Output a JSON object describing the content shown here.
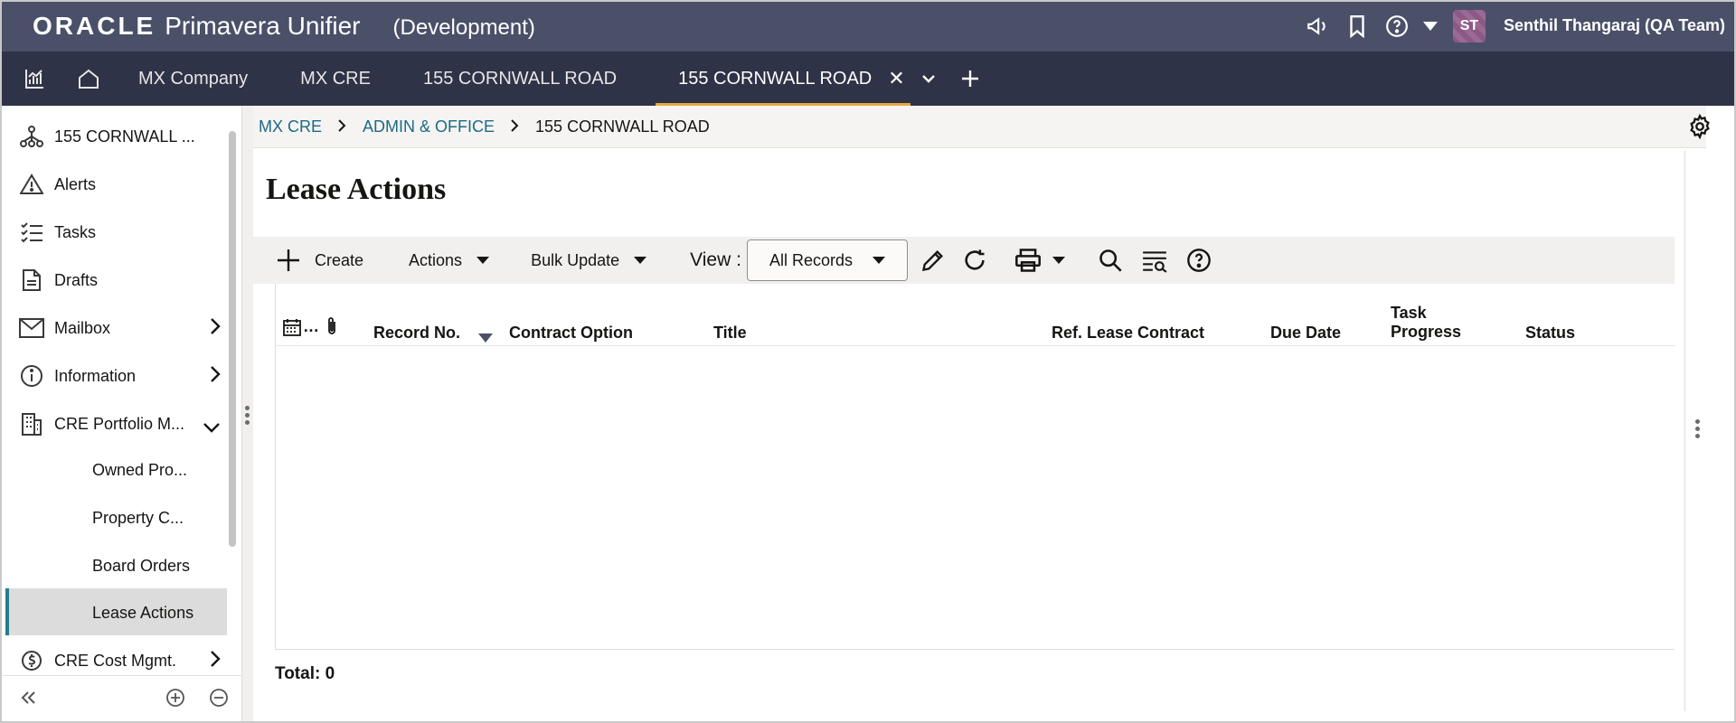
{
  "header": {
    "brand": "ORACLE",
    "product": "Primavera Unifier",
    "environment": "(Development)",
    "avatar_initials": "ST",
    "user_name": "Senthil Thangaraj (QA Team)",
    "icons": [
      "megaphone-icon",
      "bookmark-icon",
      "help-icon",
      "caret-down-icon"
    ]
  },
  "tabs": [
    {
      "label": "MX Company"
    },
    {
      "label": "MX CRE"
    },
    {
      "label": "155 CORNWALL ROAD"
    },
    {
      "label": "155 CORNWALL ROAD",
      "active": true
    }
  ],
  "sidebar": {
    "items": [
      {
        "label": "155 CORNWALL ...",
        "icon": "hierarchy-icon"
      },
      {
        "label": "Alerts",
        "icon": "alert-icon"
      },
      {
        "label": "Tasks",
        "icon": "tasks-icon"
      },
      {
        "label": "Drafts",
        "icon": "drafts-icon"
      },
      {
        "label": "Mailbox",
        "icon": "mail-icon"
      },
      {
        "label": "Information",
        "icon": "info-icon"
      },
      {
        "label": "CRE Portfolio M...",
        "icon": "building-icon"
      },
      {
        "label": "CRE Cost Mgmt.",
        "icon": "cost-icon"
      }
    ],
    "sub_items": [
      {
        "label": "Owned Pro..."
      },
      {
        "label": "Property C..."
      },
      {
        "label": "Board Orders"
      },
      {
        "label": "Lease Actions",
        "active": true
      }
    ]
  },
  "breadcrumb": {
    "items": [
      "MX CRE",
      "ADMIN & OFFICE"
    ],
    "current": "155 CORNWALL ROAD"
  },
  "page": {
    "title": "Lease Actions"
  },
  "toolbar": {
    "create_label": "Create",
    "actions_label": "Actions",
    "bulk_update_label": "Bulk Update",
    "view_label": "View :",
    "view_value": "All Records"
  },
  "grid": {
    "columns": {
      "record_no": "Record No.",
      "contract_option": "Contract Option",
      "title": "Title",
      "ref_lease_contract": "Ref. Lease Contract",
      "due_date": "Due Date",
      "task_progress_1": "Task",
      "task_progress_2": "Progress",
      "status": "Status"
    },
    "total_label": "Total: 0"
  },
  "colors": {
    "header_bg": "#4b5069",
    "tabs_bg": "#2f3347",
    "active_tab_underline": "#e5a93d",
    "link": "#1d6a85",
    "active_nav_border": "#287a8e"
  }
}
